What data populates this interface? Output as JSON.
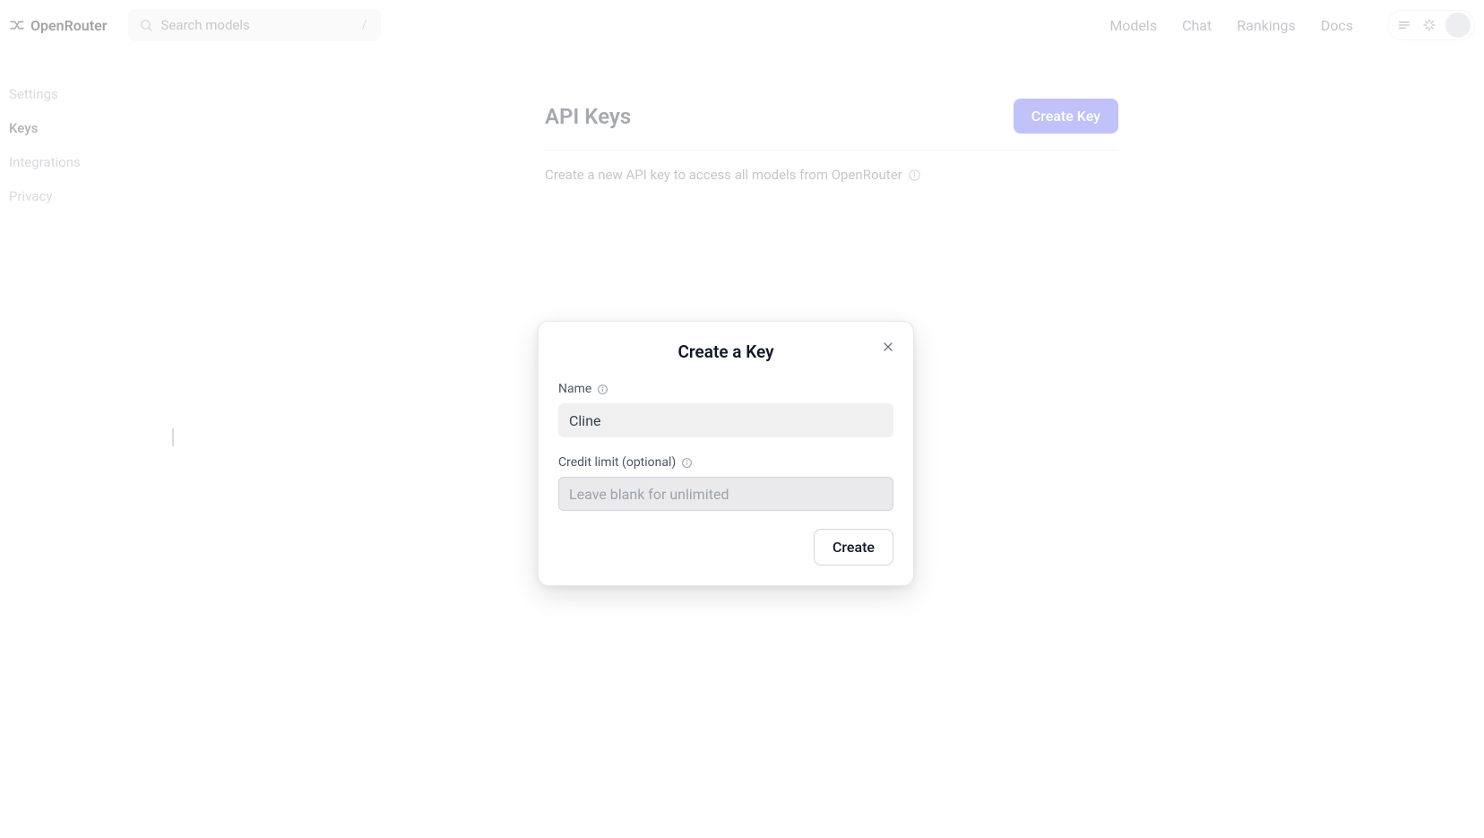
{
  "header": {
    "brand": "OpenRouter",
    "search_placeholder": "Search models",
    "search_shortcut": "/",
    "nav": [
      "Models",
      "Chat",
      "Rankings",
      "Docs"
    ]
  },
  "sidebar": {
    "items": [
      {
        "label": "Settings",
        "active": false
      },
      {
        "label": "Keys",
        "active": true
      },
      {
        "label": "Integrations",
        "active": false
      },
      {
        "label": "Privacy",
        "active": false
      }
    ]
  },
  "page": {
    "title": "API Keys",
    "create_button": "Create Key",
    "subtitle": "Create a new API key to access all models from OpenRouter"
  },
  "modal": {
    "title": "Create a Key",
    "name_label": "Name",
    "name_value": "Cline",
    "credit_label": "Credit limit (optional)",
    "credit_placeholder": "Leave blank for unlimited",
    "credit_value": "",
    "submit_label": "Create"
  }
}
